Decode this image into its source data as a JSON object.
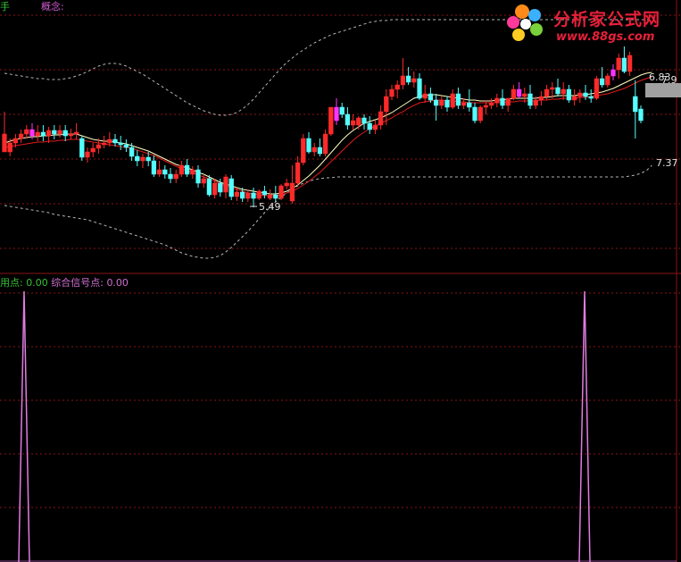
{
  "header": {
    "left_label": "手",
    "concept_label": "概念:"
  },
  "logo": {
    "title": "分析家公式网",
    "url": "www.88gs.com"
  },
  "indicator": {
    "name1": "用点:",
    "val1": "0.00",
    "name2": "综合信号点:",
    "val2": "0.00"
  },
  "colors": {
    "up": "#ff2a2a",
    "down": "#54ffff",
    "special": "#ff33ff",
    "grid": "#8a1414",
    "band": "#b4b4b4",
    "ma_fast": "#ffffc0",
    "ma_slow": "#e21b1b",
    "signal": "#e07ce0"
  },
  "chart_data": [
    {
      "type": "candlestick",
      "y_scale": "pixel-approximated (no axis printed)",
      "annotations": [
        {
          "label": "5.49",
          "kind": "low-marker",
          "bar_index": 45
        },
        {
          "label": "6.83",
          "kind": "right-value",
          "bar_index": 117
        },
        {
          "label": "7.9",
          "kind": "right-value",
          "bar_index": 117
        },
        {
          "label": "7.37",
          "kind": "right-value",
          "bar_index": 117
        }
      ],
      "candles": [
        {
          "o": 170,
          "h": 125,
          "c": 150,
          "l": 165
        },
        {
          "o": 170,
          "h": 155,
          "c": 160,
          "l": 175
        },
        {
          "o": 160,
          "h": 150,
          "c": 155,
          "l": 165
        },
        {
          "o": 155,
          "h": 145,
          "c": 150,
          "l": 160
        },
        {
          "o": 150,
          "h": 140,
          "c": 145,
          "l": 155
        },
        {
          "o": 145,
          "h": 138,
          "c": 152,
          "l": 156
        },
        {
          "o": 152,
          "h": 140,
          "c": 148,
          "l": 158
        },
        {
          "o": 148,
          "h": 140,
          "c": 152,
          "l": 158
        },
        {
          "o": 152,
          "h": 142,
          "c": 146,
          "l": 160
        },
        {
          "o": 146,
          "h": 140,
          "c": 150,
          "l": 156
        },
        {
          "o": 150,
          "h": 140,
          "c": 146,
          "l": 154
        },
        {
          "o": 146,
          "h": 140,
          "c": 152,
          "l": 158
        },
        {
          "o": 152,
          "h": 144,
          "c": 150,
          "l": 156
        },
        {
          "o": 150,
          "h": 138,
          "c": 148,
          "l": 156
        },
        {
          "o": 155,
          "h": 152,
          "c": 176,
          "l": 180
        },
        {
          "o": 176,
          "h": 165,
          "c": 170,
          "l": 182
        },
        {
          "o": 170,
          "h": 160,
          "c": 166,
          "l": 176
        },
        {
          "o": 166,
          "h": 155,
          "c": 162,
          "l": 172
        },
        {
          "o": 162,
          "h": 152,
          "c": 160,
          "l": 166
        },
        {
          "o": 160,
          "h": 148,
          "c": 156,
          "l": 164
        },
        {
          "o": 156,
          "h": 150,
          "c": 160,
          "l": 164
        },
        {
          "o": 160,
          "h": 152,
          "c": 162,
          "l": 168
        },
        {
          "o": 162,
          "h": 156,
          "c": 165,
          "l": 170
        },
        {
          "o": 165,
          "h": 160,
          "c": 175,
          "l": 180
        },
        {
          "o": 175,
          "h": 168,
          "c": 180,
          "l": 186
        },
        {
          "o": 180,
          "h": 172,
          "c": 176,
          "l": 188
        },
        {
          "o": 176,
          "h": 170,
          "c": 180,
          "l": 186
        },
        {
          "o": 180,
          "h": 174,
          "c": 195,
          "l": 198
        },
        {
          "o": 195,
          "h": 180,
          "c": 190,
          "l": 198
        },
        {
          "o": 190,
          "h": 185,
          "c": 195,
          "l": 200
        },
        {
          "o": 195,
          "h": 188,
          "c": 200,
          "l": 205
        },
        {
          "o": 200,
          "h": 190,
          "c": 195,
          "l": 205
        },
        {
          "o": 195,
          "h": 180,
          "c": 185,
          "l": 198
        },
        {
          "o": 185,
          "h": 178,
          "c": 195,
          "l": 198
        },
        {
          "o": 195,
          "h": 186,
          "c": 190,
          "l": 200
        },
        {
          "o": 190,
          "h": 185,
          "c": 205,
          "l": 210
        },
        {
          "o": 205,
          "h": 195,
          "c": 200,
          "l": 210
        },
        {
          "o": 200,
          "h": 196,
          "c": 218,
          "l": 220
        },
        {
          "o": 218,
          "h": 200,
          "c": 205,
          "l": 222
        },
        {
          "o": 205,
          "h": 200,
          "c": 215,
          "l": 220
        },
        {
          "o": 215,
          "h": 195,
          "c": 198,
          "l": 222
        },
        {
          "o": 200,
          "h": 196,
          "c": 220,
          "l": 224
        },
        {
          "o": 220,
          "h": 210,
          "c": 215,
          "l": 225
        },
        {
          "o": 215,
          "h": 210,
          "c": 222,
          "l": 226
        },
        {
          "o": 222,
          "h": 212,
          "c": 216,
          "l": 226
        },
        {
          "o": 216,
          "h": 210,
          "c": 222,
          "l": 232
        },
        {
          "o": 222,
          "h": 212,
          "c": 214,
          "l": 224
        },
        {
          "o": 214,
          "h": 208,
          "c": 218,
          "l": 222
        },
        {
          "o": 222,
          "h": 212,
          "c": 218,
          "l": 224
        },
        {
          "o": 218,
          "h": 208,
          "c": 222,
          "l": 226
        },
        {
          "o": 222,
          "h": 206,
          "c": 208,
          "l": 224
        },
        {
          "o": 208,
          "h": 200,
          "c": 205,
          "l": 212
        },
        {
          "o": 225,
          "h": 185,
          "c": 205,
          "l": 228
        },
        {
          "o": 205,
          "h": 175,
          "c": 182,
          "l": 208
        },
        {
          "o": 182,
          "h": 150,
          "c": 155,
          "l": 185
        },
        {
          "o": 155,
          "h": 148,
          "c": 170,
          "l": 172
        },
        {
          "o": 170,
          "h": 160,
          "c": 165,
          "l": 175
        },
        {
          "o": 165,
          "h": 155,
          "c": 172,
          "l": 175
        },
        {
          "o": 172,
          "h": 145,
          "c": 150,
          "l": 175
        },
        {
          "o": 150,
          "h": 128,
          "c": 120,
          "l": 152
        },
        {
          "o": 135,
          "h": 110,
          "c": 120,
          "l": 140
        },
        {
          "o": 120,
          "h": 115,
          "c": 128,
          "l": 132
        },
        {
          "o": 128,
          "h": 120,
          "c": 140,
          "l": 145
        },
        {
          "o": 140,
          "h": 128,
          "c": 135,
          "l": 145
        },
        {
          "o": 140,
          "h": 130,
          "c": 132,
          "l": 145
        },
        {
          "o": 132,
          "h": 128,
          "c": 138,
          "l": 145
        },
        {
          "o": 138,
          "h": 130,
          "c": 145,
          "l": 150
        },
        {
          "o": 145,
          "h": 135,
          "c": 140,
          "l": 150
        },
        {
          "o": 140,
          "h": 118,
          "c": 125,
          "l": 145
        },
        {
          "o": 125,
          "h": 100,
          "c": 108,
          "l": 140
        },
        {
          "o": 108,
          "h": 95,
          "c": 100,
          "l": 112
        },
        {
          "o": 100,
          "h": 90,
          "c": 95,
          "l": 110
        },
        {
          "o": 95,
          "h": 65,
          "c": 85,
          "l": 100
        },
        {
          "o": 85,
          "h": 75,
          "c": 92,
          "l": 95
        },
        {
          "o": 92,
          "h": 80,
          "c": 88,
          "l": 98
        },
        {
          "o": 88,
          "h": 82,
          "c": 110,
          "l": 112
        },
        {
          "o": 110,
          "h": 95,
          "c": 105,
          "l": 115
        },
        {
          "o": 105,
          "h": 98,
          "c": 112,
          "l": 115
        },
        {
          "o": 112,
          "h": 105,
          "c": 118,
          "l": 135
        },
        {
          "o": 118,
          "h": 108,
          "c": 112,
          "l": 122
        },
        {
          "o": 112,
          "h": 108,
          "c": 120,
          "l": 125
        },
        {
          "o": 120,
          "h": 100,
          "c": 105,
          "l": 122
        },
        {
          "o": 105,
          "h": 98,
          "c": 118,
          "l": 122
        },
        {
          "o": 118,
          "h": 110,
          "c": 115,
          "l": 122
        },
        {
          "o": 115,
          "h": 100,
          "c": 120,
          "l": 125
        },
        {
          "o": 120,
          "h": 115,
          "c": 135,
          "l": 138
        },
        {
          "o": 135,
          "h": 118,
          "c": 120,
          "l": 138
        },
        {
          "o": 120,
          "h": 112,
          "c": 118,
          "l": 128
        },
        {
          "o": 118,
          "h": 110,
          "c": 115,
          "l": 122
        },
        {
          "o": 115,
          "h": 105,
          "c": 110,
          "l": 120
        },
        {
          "o": 110,
          "h": 100,
          "c": 118,
          "l": 122
        },
        {
          "o": 118,
          "h": 112,
          "c": 110,
          "l": 125
        },
        {
          "o": 110,
          "h": 95,
          "c": 100,
          "l": 112
        },
        {
          "o": 100,
          "h": 92,
          "c": 108,
          "l": 110
        },
        {
          "o": 108,
          "h": 98,
          "c": 105,
          "l": 115
        },
        {
          "o": 105,
          "h": 95,
          "c": 118,
          "l": 122
        },
        {
          "o": 118,
          "h": 108,
          "c": 112,
          "l": 122
        },
        {
          "o": 112,
          "h": 102,
          "c": 108,
          "l": 118
        },
        {
          "o": 108,
          "h": 95,
          "c": 100,
          "l": 112
        },
        {
          "o": 100,
          "h": 92,
          "c": 98,
          "l": 110
        },
        {
          "o": 98,
          "h": 88,
          "c": 105,
          "l": 108
        },
        {
          "o": 105,
          "h": 92,
          "c": 100,
          "l": 112
        },
        {
          "o": 100,
          "h": 95,
          "c": 112,
          "l": 115
        },
        {
          "o": 112,
          "h": 100,
          "c": 108,
          "l": 118
        },
        {
          "o": 108,
          "h": 100,
          "c": 104,
          "l": 115
        },
        {
          "o": 104,
          "h": 95,
          "c": 108,
          "l": 112
        },
        {
          "o": 108,
          "h": 100,
          "c": 110,
          "l": 115
        },
        {
          "o": 110,
          "h": 85,
          "c": 88,
          "l": 112
        },
        {
          "o": 88,
          "h": 75,
          "c": 95,
          "l": 98
        },
        {
          "o": 95,
          "h": 82,
          "c": 85,
          "l": 98
        },
        {
          "o": 85,
          "h": 72,
          "c": 78,
          "l": 90
        },
        {
          "o": 78,
          "h": 60,
          "c": 65,
          "l": 88
        },
        {
          "o": 65,
          "h": 52,
          "c": 80,
          "l": 82
        },
        {
          "o": 80,
          "h": 58,
          "c": 62,
          "l": 85
        },
        {
          "o": 108,
          "h": 90,
          "c": 125,
          "l": 155
        },
        {
          "o": 122,
          "h": 118,
          "c": 135,
          "l": 138
        }
      ],
      "special_bars": [
        5,
        60,
        93,
        110
      ],
      "ma_fast": [
        160,
        158,
        156,
        155,
        154,
        153,
        153,
        152,
        152,
        151,
        151,
        150,
        150,
        150,
        152,
        154,
        156,
        157,
        158,
        158,
        159,
        160,
        161,
        163,
        165,
        167,
        169,
        172,
        175,
        178,
        181,
        184,
        186,
        188,
        190,
        193,
        195,
        198,
        201,
        204,
        206,
        208,
        210,
        212,
        213,
        214,
        215,
        216,
        217,
        217,
        216,
        214,
        211,
        207,
        202,
        197,
        191,
        185,
        178,
        171,
        164,
        157,
        151,
        146,
        142,
        138,
        136,
        134,
        132,
        129,
        126,
        122,
        118,
        114,
        110,
        108,
        107,
        106,
        106,
        107,
        108,
        109,
        110,
        111,
        112,
        112,
        113,
        113,
        113,
        112,
        112,
        111,
        110,
        110,
        110,
        110,
        110,
        109,
        109,
        108,
        107,
        107,
        107,
        107,
        106,
        106,
        105,
        104,
        103,
        101,
        99,
        96,
        93,
        90,
        87,
        84,
        82,
        81
      ],
      "ma_slow": [
        165,
        164,
        163,
        162,
        161,
        160,
        159,
        159,
        158,
        158,
        157,
        157,
        156,
        156,
        157,
        158,
        159,
        160,
        161,
        162,
        163,
        164,
        165,
        166,
        168,
        170,
        172,
        174,
        177,
        180,
        183,
        186,
        189,
        191,
        193,
        196,
        198,
        200,
        203,
        206,
        208,
        210,
        212,
        214,
        216,
        217,
        218,
        219,
        219,
        219,
        218,
        216,
        214,
        211,
        207,
        203,
        198,
        193,
        187,
        181,
        175,
        169,
        163,
        157,
        152,
        148,
        144,
        141,
        138,
        135,
        132,
        128,
        125,
        121,
        118,
        115,
        114,
        113,
        112,
        112,
        113,
        113,
        114,
        114,
        115,
        115,
        115,
        115,
        115,
        115,
        115,
        114,
        114,
        113,
        113,
        113,
        113,
        112,
        112,
        111,
        111,
        110,
        110,
        110,
        109,
        109,
        108,
        107,
        106,
        105,
        103,
        101,
        99,
        96,
        93,
        90,
        88,
        86
      ],
      "band_upper": [
        82,
        83,
        84,
        85,
        86,
        87,
        88,
        88,
        89,
        89,
        89,
        88,
        87,
        85,
        83,
        80,
        77,
        74,
        72,
        71,
        71,
        72,
        74,
        77,
        80,
        83,
        87,
        91,
        95,
        99,
        103,
        107,
        111,
        115,
        118,
        121,
        124,
        126,
        128,
        129,
        129,
        128,
        126,
        122,
        117,
        111,
        104,
        97,
        90,
        83,
        76,
        70,
        65,
        60,
        56,
        52,
        48,
        45,
        42,
        39,
        37,
        35,
        33,
        31,
        29,
        27,
        25,
        24,
        23,
        23,
        22,
        22,
        22,
        22,
        22,
        22,
        22,
        22,
        22,
        22,
        22,
        22,
        22,
        22,
        22,
        22,
        22,
        22,
        22,
        22,
        22,
        22,
        22,
        22,
        22,
        22,
        22,
        22,
        22,
        22,
        22,
        22,
        22,
        22,
        22,
        22,
        22,
        22,
        22,
        22,
        22,
        22,
        22,
        22,
        22,
        22,
        22,
        22
      ],
      "band_lower": [
        230,
        231,
        232,
        233,
        234,
        235,
        236,
        237,
        238,
        240,
        241,
        242,
        243,
        244,
        245,
        246,
        248,
        250,
        252,
        254,
        256,
        258,
        260,
        262,
        264,
        266,
        268,
        270,
        272,
        274,
        277,
        280,
        283,
        285,
        287,
        288,
        289,
        289,
        288,
        286,
        282,
        277,
        271,
        265,
        259,
        252,
        245,
        238,
        232,
        226,
        221,
        216,
        212,
        208,
        205,
        203,
        201,
        200,
        199,
        199,
        198,
        198,
        198,
        198,
        198,
        198,
        198,
        198,
        198,
        198,
        198,
        198,
        198,
        198,
        198,
        198,
        198,
        198,
        198,
        198,
        198,
        198,
        198,
        198,
        198,
        198,
        198,
        198,
        198,
        198,
        198,
        198,
        198,
        198,
        198,
        198,
        198,
        198,
        198,
        198,
        198,
        198,
        198,
        198,
        198,
        198,
        198,
        198,
        198,
        198,
        198,
        198,
        198,
        197,
        196,
        194,
        191,
        185
      ]
    },
    {
      "type": "line",
      "series": [
        {
          "name": "综合信号点",
          "values": [
            0,
            1,
            0,
            0,
            1,
            0
          ]
        }
      ],
      "signal_positions": [
        3,
        112
      ]
    }
  ]
}
